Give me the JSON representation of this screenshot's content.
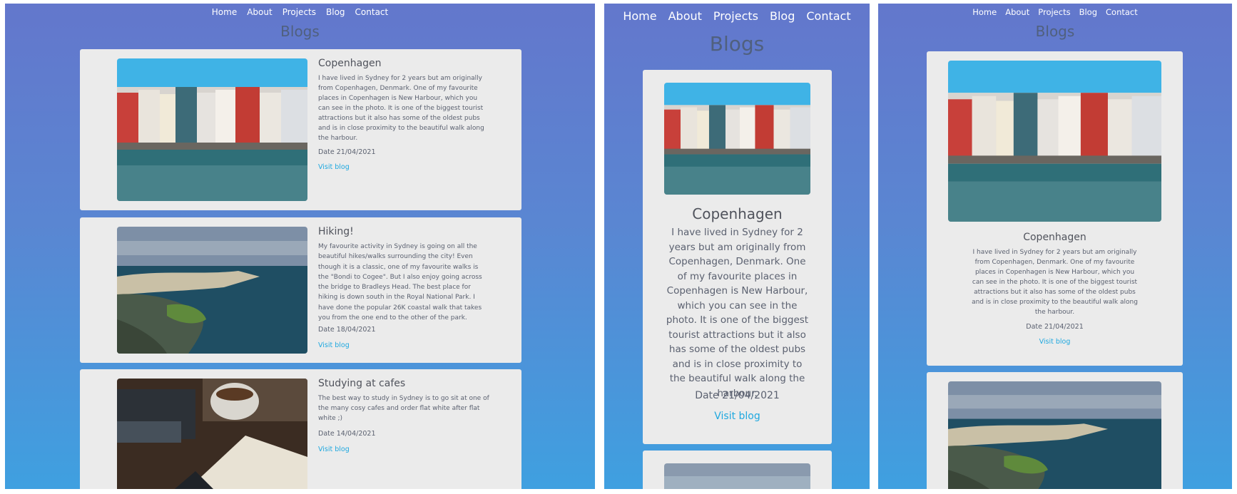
{
  "nav": [
    "Home",
    "About",
    "Projects",
    "Blog",
    "Contact"
  ],
  "heading": "Blogs",
  "date_prefix": "Date ",
  "link_label": "Visit blog",
  "posts": [
    {
      "title": "Copenhagen",
      "date": "21/04/2021",
      "image": "nyhavn-harbour-photo",
      "text": "I have lived in Sydney for 2 years but am originally from Copenhagen, Denmark. One of my favourite places in Copenhagen is New Harbour, which you can see in the photo. It is one of the biggest tourist attractions but it also has some of the oldest pubs and is in close proximity to the beautiful walk along the harbour."
    },
    {
      "title": "Hiking!",
      "date": "18/04/2021",
      "image": "coastal-beach-aerial-photo",
      "text": "My favourite activity in Sydney is going on all the beautiful hikes/walks surrounding the city! Even though it is a classic, one of my favourite walks is the \"Bondi to Cogee\". But I also enjoy going across the bridge to Bradleys Head. The best place for hiking is down south in the Royal National Park. I have done the popular 26K coastal walk that takes you from the one end to the other of the park."
    },
    {
      "title": "Studying at cafes",
      "date": "14/04/2021",
      "image": "coffee-and-notebook-photo",
      "text": "The best way to study in Sydney is to go sit at one of the many cosy cafes and order flat white after flat white ;)"
    }
  ],
  "colors": {
    "bg_top": "#6377cc",
    "bg_bottom": "#3fa0e0",
    "card": "#ebebeb",
    "link": "#1fa8df",
    "heading": "#50607e"
  }
}
